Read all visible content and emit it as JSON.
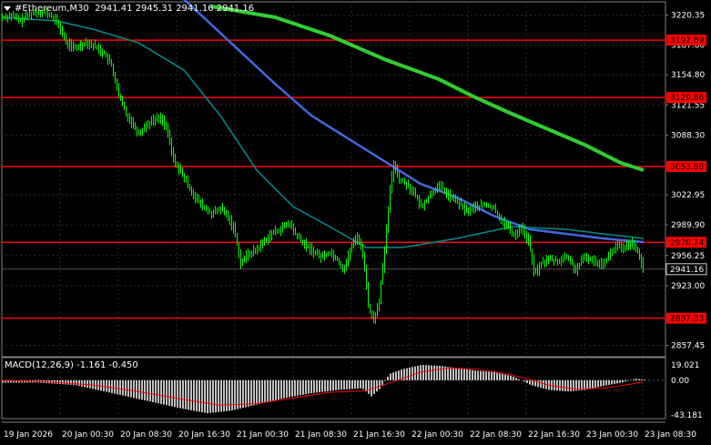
{
  "header": {
    "symbol_timeframe": "#Ethereum,M30",
    "ohlc": "2941.41 2945.31 2941.16 2941.16"
  },
  "price_axis": {
    "ticks": [
      "3220.35",
      "3187.60",
      "3154.80",
      "3121.55",
      "3088.30",
      "3022.95",
      "2989.90",
      "2956.25",
      "2923.00",
      "2857.45"
    ],
    "current_price": "2941.16",
    "levels": [
      {
        "label": "3192.89",
        "value": 3192.89
      },
      {
        "label": "3129.86",
        "value": 3129.86
      },
      {
        "label": "3053.98",
        "value": 3053.98
      },
      {
        "label": "2970.74",
        "value": 2970.74
      },
      {
        "label": "2887.33",
        "value": 2887.33
      }
    ]
  },
  "macd": {
    "title": "MACD(12,26,9) -1.161 -0.450",
    "ticks": [
      "19.021",
      "0.00",
      "-43.181"
    ]
  },
  "time_axis": {
    "labels": [
      "19 Jan 2026",
      "20 Jan 00:30",
      "20 Jan 08:30",
      "20 Jan 16:30",
      "21 Jan 00:30",
      "21 Jan 08:30",
      "21 Jan 16:30",
      "22 Jan 00:30",
      "22 Jan 08:30",
      "22 Jan 16:30",
      "23 Jan 00:30",
      "23 Jan 08:30"
    ]
  },
  "colors": {
    "background": "#000000",
    "grid": "#2a2a2a",
    "candles": "#00ff00",
    "levels": "#ff0000",
    "ma_fast": "#4169e1",
    "ma_mid": "#008b8b",
    "ma_slow": "#32cd32",
    "macd_hist": "#c0c0c0",
    "macd_signal": "#ff0000",
    "text": "#ffffff"
  },
  "chart_data": {
    "type": "candlestick",
    "y_range": [
      2845,
      3235
    ],
    "price_path": [
      [
        0,
        3218
      ],
      [
        10,
        3220
      ],
      [
        20,
        3214
      ],
      [
        30,
        3222
      ],
      [
        45,
        3225
      ],
      [
        55,
        3218
      ],
      [
        62,
        3210
      ],
      [
        70,
        3190
      ],
      [
        80,
        3184
      ],
      [
        92,
        3191
      ],
      [
        102,
        3186
      ],
      [
        112,
        3178
      ],
      [
        120,
        3165
      ],
      [
        128,
        3132
      ],
      [
        136,
        3112
      ],
      [
        144,
        3100
      ],
      [
        150,
        3090
      ],
      [
        156,
        3098
      ],
      [
        165,
        3105
      ],
      [
        175,
        3108
      ],
      [
        182,
        3090
      ],
      [
        188,
        3062
      ],
      [
        196,
        3048
      ],
      [
        205,
        3032
      ],
      [
        212,
        3020
      ],
      [
        220,
        3010
      ],
      [
        230,
        3002
      ],
      [
        240,
        3008
      ],
      [
        248,
        2998
      ],
      [
        255,
        2985
      ],
      [
        262,
        2948
      ],
      [
        270,
        2958
      ],
      [
        278,
        2962
      ],
      [
        286,
        2970
      ],
      [
        295,
        2980
      ],
      [
        305,
        2985
      ],
      [
        315,
        2992
      ],
      [
        322,
        2980
      ],
      [
        330,
        2970
      ],
      [
        340,
        2962
      ],
      [
        350,
        2955
      ],
      [
        360,
        2960
      ],
      [
        368,
        2952
      ],
      [
        375,
        2940
      ],
      [
        383,
        2965
      ],
      [
        390,
        2978
      ],
      [
        397,
        2955
      ],
      [
        402,
        2900
      ],
      [
        408,
        2885
      ],
      [
        414,
        2908
      ],
      [
        420,
        2960
      ],
      [
        425,
        3020
      ],
      [
        430,
        3058
      ],
      [
        436,
        3040
      ],
      [
        444,
        3035
      ],
      [
        452,
        3025
      ],
      [
        460,
        3010
      ],
      [
        468,
        3020
      ],
      [
        475,
        3030
      ],
      [
        482,
        3032
      ],
      [
        490,
        3022
      ],
      [
        500,
        3015
      ],
      [
        510,
        3005
      ],
      [
        520,
        3010
      ],
      [
        530,
        3012
      ],
      [
        540,
        3008
      ],
      [
        548,
        2995
      ],
      [
        555,
        2988
      ],
      [
        562,
        2978
      ],
      [
        570,
        2988
      ],
      [
        578,
        2972
      ],
      [
        585,
        2935
      ],
      [
        592,
        2948
      ],
      [
        600,
        2952
      ],
      [
        610,
        2950
      ],
      [
        620,
        2955
      ],
      [
        630,
        2940
      ],
      [
        640,
        2955
      ],
      [
        650,
        2950
      ],
      [
        660,
        2948
      ],
      [
        668,
        2958
      ],
      [
        675,
        2968
      ],
      [
        682,
        2962
      ],
      [
        690,
        2970
      ],
      [
        698,
        2960
      ],
      [
        705,
        2941
      ]
    ],
    "ma_fast": [
      [
        0,
        3256
      ],
      [
        200,
        3238
      ],
      [
        300,
        3145
      ],
      [
        340,
        3110
      ],
      [
        380,
        3085
      ],
      [
        420,
        3060
      ],
      [
        460,
        3035
      ],
      [
        500,
        3020
      ],
      [
        540,
        3000
      ],
      [
        580,
        2985
      ],
      [
        620,
        2980
      ],
      [
        660,
        2975
      ],
      [
        705,
        2971
      ]
    ],
    "ma_mid": [
      [
        0,
        3218
      ],
      [
        60,
        3214
      ],
      [
        100,
        3205
      ],
      [
        150,
        3190
      ],
      [
        200,
        3160
      ],
      [
        240,
        3110
      ],
      [
        280,
        3050
      ],
      [
        320,
        3010
      ],
      [
        360,
        2988
      ],
      [
        400,
        2965
      ],
      [
        440,
        2965
      ],
      [
        500,
        2975
      ],
      [
        560,
        2988
      ],
      [
        620,
        2985
      ],
      [
        660,
        2980
      ],
      [
        705,
        2975
      ]
    ],
    "ma_slow": [
      [
        230,
        3230
      ],
      [
        300,
        3218
      ],
      [
        360,
        3198
      ],
      [
        420,
        3172
      ],
      [
        480,
        3150
      ],
      [
        520,
        3130
      ],
      [
        560,
        3112
      ],
      [
        600,
        3095
      ],
      [
        640,
        3078
      ],
      [
        680,
        3058
      ],
      [
        705,
        3050
      ]
    ],
    "macd_hist": [
      [
        0,
        -3
      ],
      [
        40,
        -3
      ],
      [
        80,
        -6
      ],
      [
        120,
        -16
      ],
      [
        160,
        -26
      ],
      [
        200,
        -36
      ],
      [
        225,
        -41
      ],
      [
        250,
        -38
      ],
      [
        280,
        -30
      ],
      [
        310,
        -22
      ],
      [
        340,
        -16
      ],
      [
        370,
        -12
      ],
      [
        395,
        -10
      ],
      [
        405,
        -20
      ],
      [
        415,
        -10
      ],
      [
        425,
        8
      ],
      [
        440,
        14
      ],
      [
        460,
        19
      ],
      [
        480,
        18
      ],
      [
        500,
        15
      ],
      [
        520,
        12
      ],
      [
        540,
        10
      ],
      [
        560,
        5
      ],
      [
        570,
        0
      ],
      [
        580,
        -6
      ],
      [
        600,
        -12
      ],
      [
        620,
        -14
      ],
      [
        640,
        -12
      ],
      [
        660,
        -7
      ],
      [
        680,
        -3
      ],
      [
        695,
        2
      ],
      [
        705,
        1
      ]
    ],
    "macd_signal": [
      [
        0,
        0
      ],
      [
        50,
        -2
      ],
      [
        100,
        -6
      ],
      [
        150,
        -14
      ],
      [
        200,
        -24
      ],
      [
        240,
        -31
      ],
      [
        280,
        -29
      ],
      [
        320,
        -22
      ],
      [
        360,
        -15
      ],
      [
        400,
        -13
      ],
      [
        430,
        -2
      ],
      [
        460,
        10
      ],
      [
        490,
        15
      ],
      [
        520,
        14
      ],
      [
        550,
        9
      ],
      [
        580,
        1
      ],
      [
        600,
        -6
      ],
      [
        630,
        -11
      ],
      [
        660,
        -10
      ],
      [
        690,
        -5
      ],
      [
        705,
        -2
      ]
    ],
    "macd_range": [
      -43.181,
      19.021
    ]
  }
}
